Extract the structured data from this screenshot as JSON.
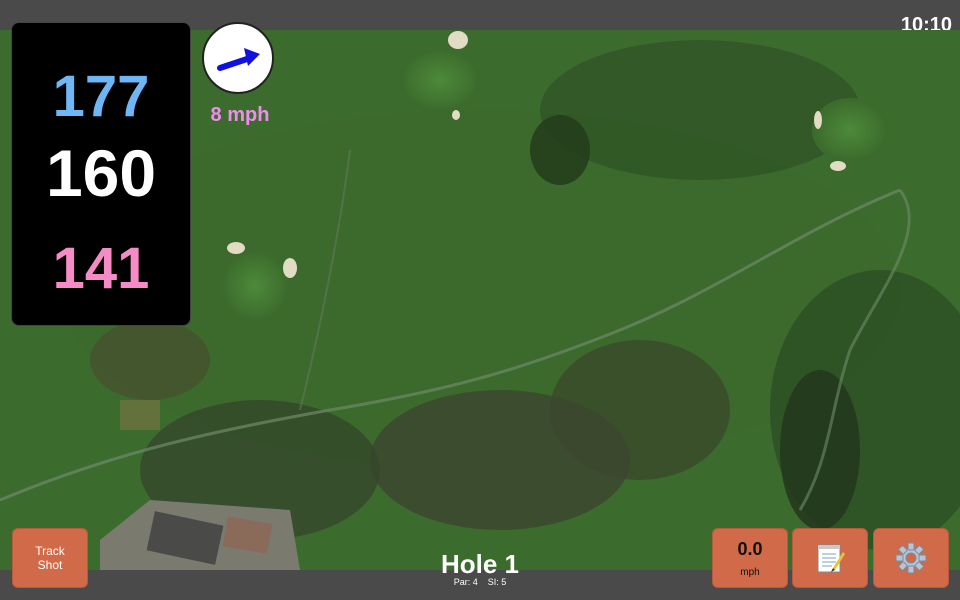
{
  "status": {
    "time": "10:10"
  },
  "distances": {
    "back": "177",
    "middle": "160",
    "front": "141"
  },
  "wind": {
    "speed_text": "8 mph",
    "direction_icon": "arrow-icon"
  },
  "buttons": {
    "track_shot": "Track\nShot",
    "speed_value": "0.0",
    "speed_unit": "mph",
    "notes_icon": "notepad-icon",
    "settings_icon": "gear-icon"
  },
  "hole": {
    "title": "Hole 1",
    "par_label": "Par: 4",
    "si_label": "SI: 5"
  },
  "colors": {
    "back": "#6fb6f5",
    "middle": "#ffffff",
    "front": "#f68cc6",
    "button": "#d06a48",
    "wind_speed": "#f08cf0"
  }
}
